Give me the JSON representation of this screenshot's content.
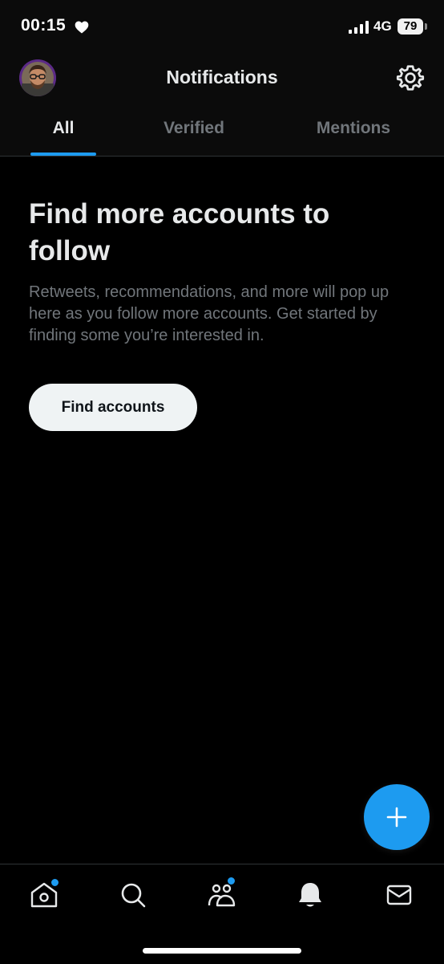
{
  "status_bar": {
    "time": "00:15",
    "network": "4G",
    "battery": "79",
    "icons": [
      "heart-icon",
      "signal-icon",
      "battery-icon"
    ]
  },
  "header": {
    "title": "Notifications",
    "avatar_icon": "avatar",
    "settings_icon": "gear-icon"
  },
  "tabs": [
    {
      "label": "All",
      "active": true
    },
    {
      "label": "Verified",
      "active": false
    },
    {
      "label": "Mentions",
      "active": false
    }
  ],
  "empty_state": {
    "title": "Find more accounts to follow",
    "description": "Retweets, recommendations, and more will pop up here as you follow more accounts. Get started by finding some you’re interested in.",
    "button_label": "Find accounts"
  },
  "fab": {
    "icon": "plus-icon"
  },
  "bottom_nav": [
    {
      "name": "home",
      "icon": "home-icon",
      "badge": true
    },
    {
      "name": "search",
      "icon": "search-icon",
      "badge": false
    },
    {
      "name": "communities",
      "icon": "communities-icon",
      "badge": true
    },
    {
      "name": "notifications",
      "icon": "bell-icon",
      "badge": false,
      "active": true
    },
    {
      "name": "messages",
      "icon": "envelope-icon",
      "badge": false
    }
  ],
  "colors": {
    "accent": "#1d9bf0",
    "background": "#000000",
    "bar_background": "#0b0b0b",
    "primary_text": "#e7e9ea",
    "secondary_text": "#71767b",
    "button_background": "#eff3f4"
  }
}
